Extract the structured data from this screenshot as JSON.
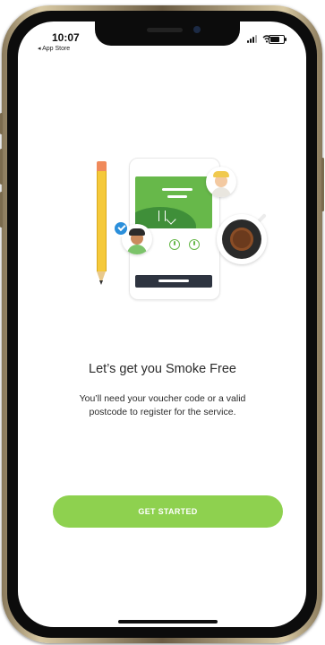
{
  "status_bar": {
    "time": "10:07",
    "back_app": "◂ App Store"
  },
  "onboarding": {
    "title": "Let’s get you Smoke Free",
    "subtitle": "You’ll need your voucher code or a valid postcode to register for the service.",
    "cta_label": "GET STARTED"
  },
  "colors": {
    "accent": "#8ed14f",
    "illustration_green": "#67b84a",
    "badge_blue": "#2b8fdb"
  },
  "icons": [
    "signal-icon",
    "wifi-icon",
    "battery-icon",
    "pencil-icon",
    "check-badge-icon",
    "coffee-cup-icon"
  ]
}
